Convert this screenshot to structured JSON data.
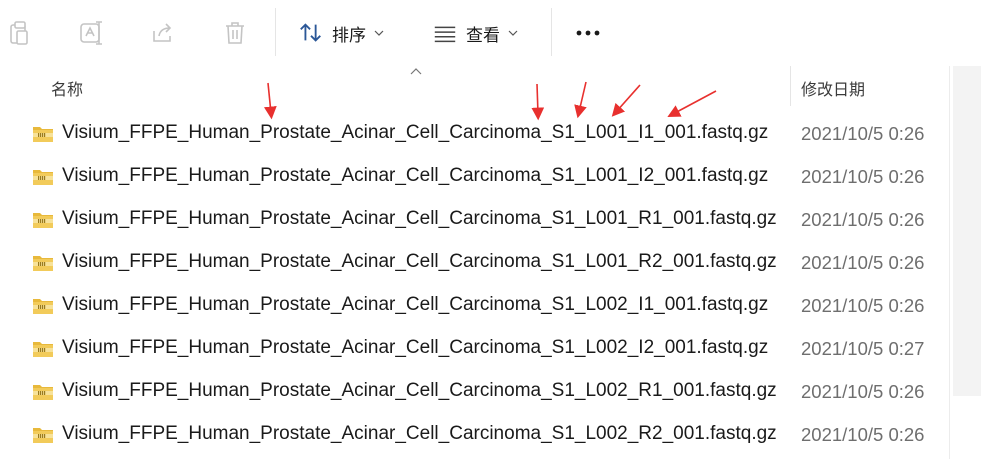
{
  "toolbar": {
    "copy_icon": "clipboard-icon",
    "rename_icon": "rename-icon",
    "share_icon": "share-icon",
    "delete_icon": "trash-icon",
    "sort_label": "排序",
    "view_label": "查看",
    "more_icon": "more-icon"
  },
  "header": {
    "name_label": "名称",
    "date_label": "修改日期"
  },
  "files": [
    {
      "name": "Visium_FFPE_Human_Prostate_Acinar_Cell_Carcinoma_S1_L001_I1_001.fastq.gz",
      "date": "2021/10/5 0:26"
    },
    {
      "name": "Visium_FFPE_Human_Prostate_Acinar_Cell_Carcinoma_S1_L001_I2_001.fastq.gz",
      "date": "2021/10/5 0:26"
    },
    {
      "name": "Visium_FFPE_Human_Prostate_Acinar_Cell_Carcinoma_S1_L001_R1_001.fastq.gz",
      "date": "2021/10/5 0:26"
    },
    {
      "name": "Visium_FFPE_Human_Prostate_Acinar_Cell_Carcinoma_S1_L001_R2_001.fastq.gz",
      "date": "2021/10/5 0:26"
    },
    {
      "name": "Visium_FFPE_Human_Prostate_Acinar_Cell_Carcinoma_S1_L002_I1_001.fastq.gz",
      "date": "2021/10/5 0:26"
    },
    {
      "name": "Visium_FFPE_Human_Prostate_Acinar_Cell_Carcinoma_S1_L002_I2_001.fastq.gz",
      "date": "2021/10/5 0:27"
    },
    {
      "name": "Visium_FFPE_Human_Prostate_Acinar_Cell_Carcinoma_S1_L002_R1_001.fastq.gz",
      "date": "2021/10/5 0:26"
    },
    {
      "name": "Visium_FFPE_Human_Prostate_Acinar_Cell_Carcinoma_S1_L002_R2_001.fastq.gz",
      "date": "2021/10/5 0:26"
    }
  ],
  "colors": {
    "annotation_arrow": "#e8302e",
    "archive_icon": "#e8b93b"
  }
}
